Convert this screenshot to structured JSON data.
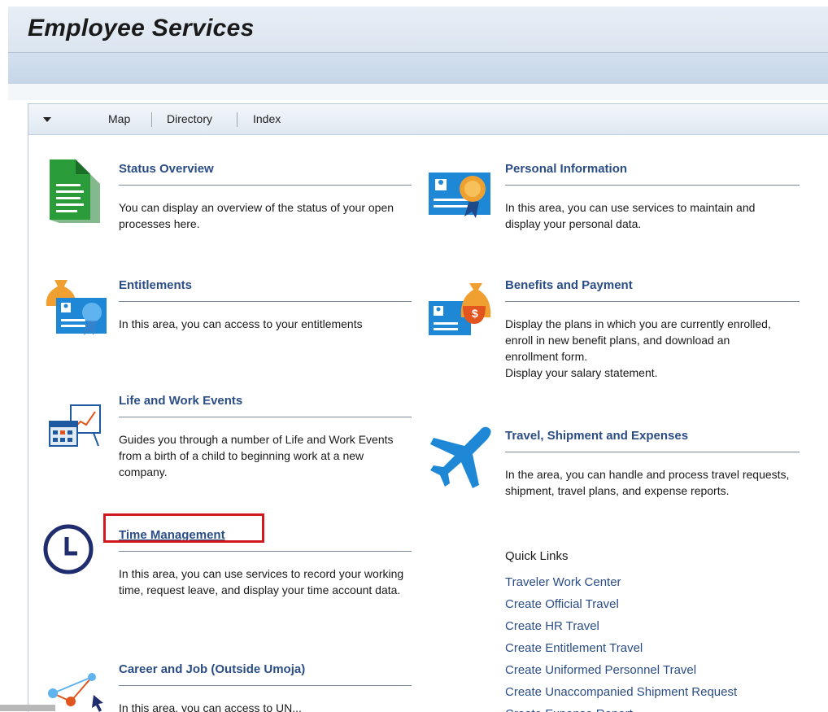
{
  "page": {
    "title": "Employee Services"
  },
  "nav": {
    "items": [
      "Map",
      "Directory",
      "Index"
    ]
  },
  "services": {
    "status_overview": {
      "title": "Status Overview",
      "desc": "You can display an overview of the status of your open processes here."
    },
    "personal_information": {
      "title": "Personal Information",
      "desc": "In this area, you can use services to maintain and display your personal data."
    },
    "entitlements": {
      "title": "Entitlements",
      "desc": "In this area, you can access to your entitlements"
    },
    "benefits_payment": {
      "title": "Benefits and Payment",
      "desc1": "Display the plans in which you are currently enrolled, enroll in new benefit plans, and download an enrollment form.",
      "desc2": "Display your salary statement."
    },
    "life_work_events": {
      "title": "Life and Work Events",
      "desc": "Guides you through a number of Life and Work Events from a birth of a child to beginning work at a new company."
    },
    "travel": {
      "title": "Travel, Shipment and Expenses",
      "desc": "In the area, you can handle and process travel requests, shipment, travel plans, and expense reports."
    },
    "time_management": {
      "title": "Time Management",
      "desc": "In this area, you can use services to record your working time, request leave, and display your time account data."
    },
    "career": {
      "title": "Career and Job (Outside Umoja)",
      "desc": "In this area, you can access to UN..."
    }
  },
  "quick_links": {
    "heading": "Quick Links",
    "items": [
      "Traveler Work Center",
      "Create Official Travel",
      "Create HR Travel",
      "Create Entitlement Travel",
      "Create Uniformed Personnel Travel",
      "Create Unaccompanied Shipment Request",
      "Create Expense Report"
    ]
  },
  "colors": {
    "link": "#2b4d86",
    "highlight": "#d0181f",
    "icon_blue": "#1e88d6",
    "icon_green": "#2a9d3a",
    "icon_orange": "#f0a030",
    "icon_navy": "#1f2d6e"
  },
  "icons": {
    "status_overview": "green-document-icon",
    "personal_information": "id-card-with-ribbon-icon",
    "entitlements": "money-bag-id-card-icon",
    "benefits_payment": "id-card-with-money-bag-icon",
    "life_work_events": "calendar-chart-icon",
    "travel": "airplane-icon",
    "time_management": "clock-icon",
    "career": "network-nodes-icon"
  }
}
